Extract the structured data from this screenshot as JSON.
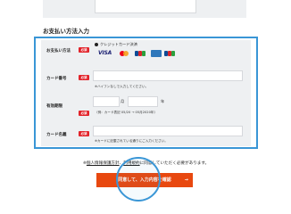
{
  "section_title": "お支払い方法入力",
  "required_badge": "必須",
  "payment_method": {
    "label": "お支払い方法",
    "option_label": "クレジットカード決済",
    "brands": [
      "visa-logo",
      "mastercard-logo",
      "jcb-logo",
      "amex-logo",
      "jcb-logo"
    ],
    "visa_text": "VISA"
  },
  "card_number": {
    "label": "カード番号",
    "note": "※ハイフンなしで入力してください。"
  },
  "expiry": {
    "label": "有効期限",
    "month_unit": "月",
    "year_unit": "年",
    "note": "（例：カード表記 05/20 → 05月2020年）"
  },
  "card_holder": {
    "label": "カード名義",
    "note": "※カードに記載されている通りにご入力ください。"
  },
  "footer": {
    "prefix": "※",
    "link1": "個人情報保護方針",
    "separator": "、",
    "link2": "利用規約",
    "suffix": "に同意していただく必要があります。"
  },
  "submit_label": "同意して、入力内容を確認",
  "submit_arrow": "→",
  "colors": {
    "accent_frame": "#3a96d6",
    "required": "#e2232a",
    "submit": "#e8480f",
    "panel_bg": "#eef0f2"
  }
}
